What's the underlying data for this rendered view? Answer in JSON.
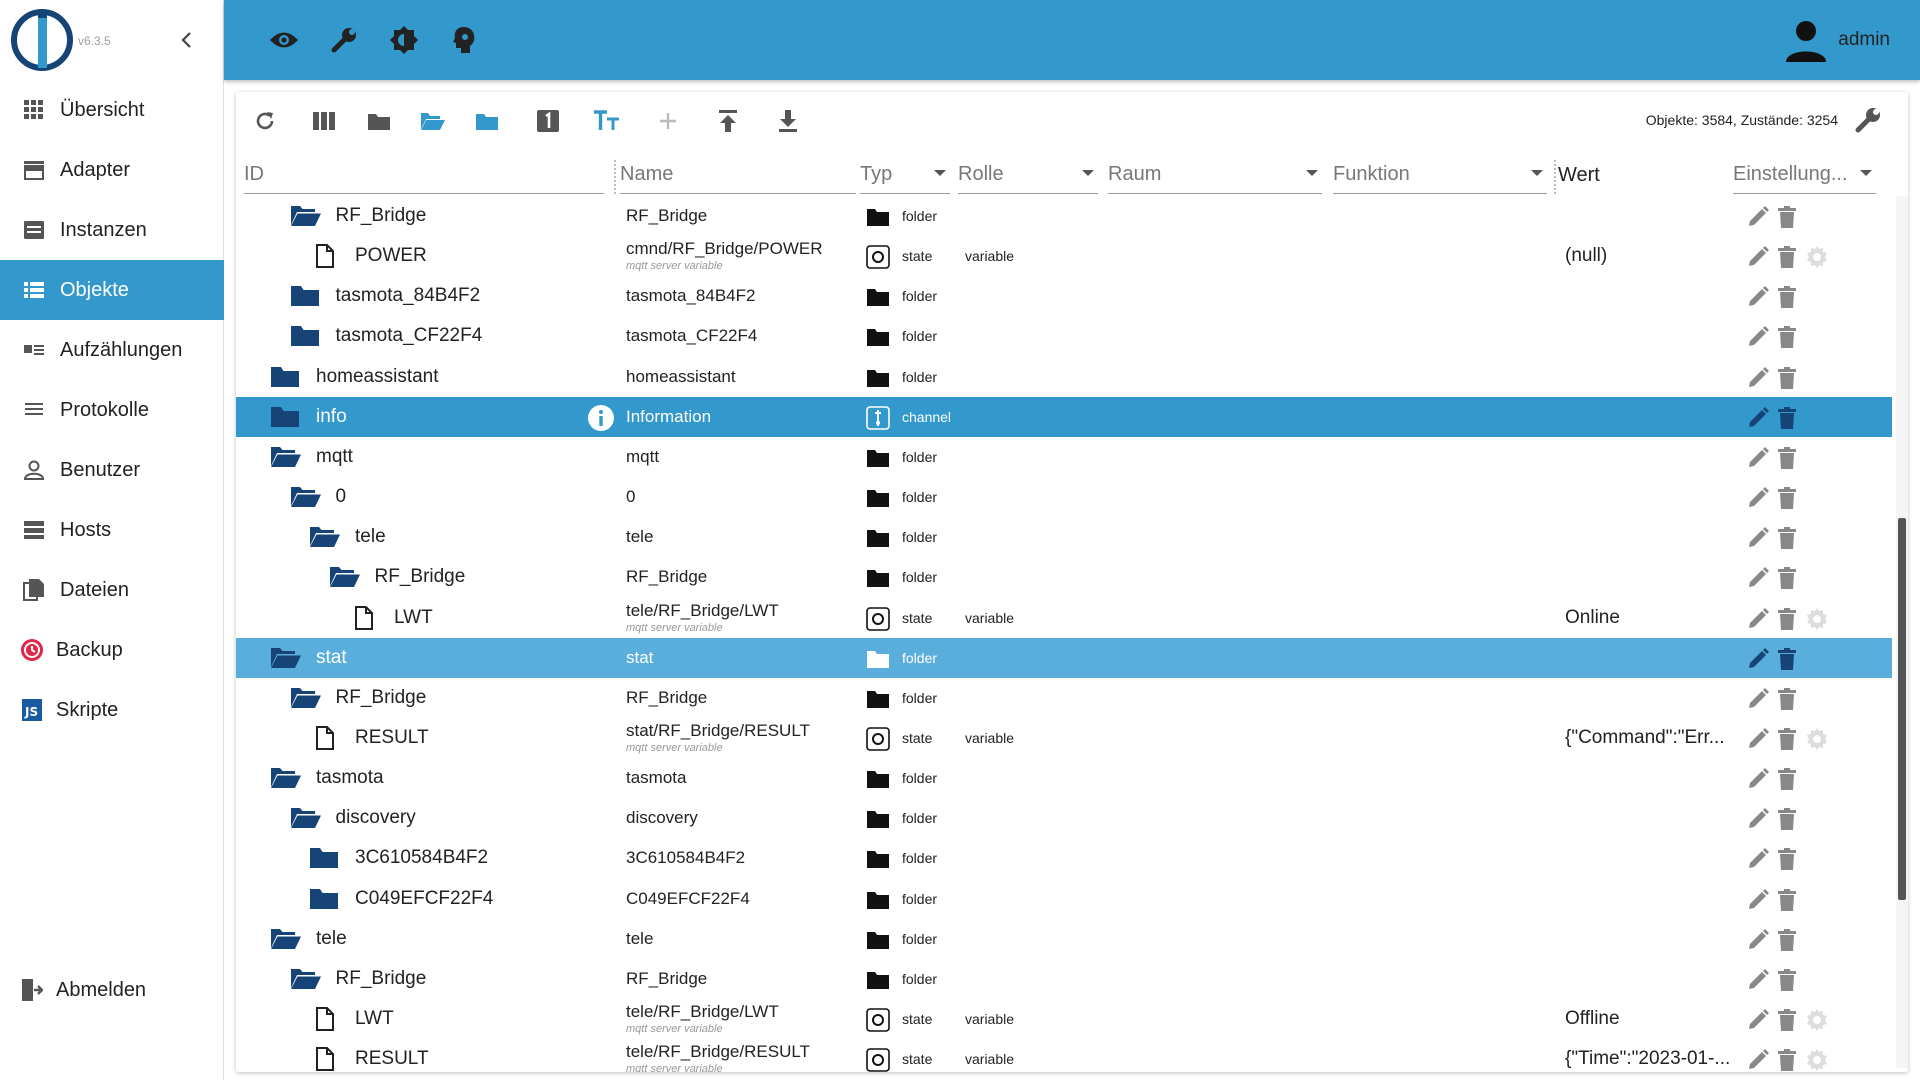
{
  "app": {
    "version": "v6.3.5"
  },
  "sidebar": {
    "items": [
      {
        "label": "Übersicht",
        "icon": "grid-icon",
        "active": false
      },
      {
        "label": "Adapter",
        "icon": "store-icon",
        "active": false
      },
      {
        "label": "Instanzen",
        "icon": "instances-icon",
        "active": false
      },
      {
        "label": "Objekte",
        "icon": "list-icon",
        "active": true
      },
      {
        "label": "Aufzählungen",
        "icon": "enums-icon",
        "active": false
      },
      {
        "label": "Protokolle",
        "icon": "logs-icon",
        "active": false
      },
      {
        "label": "Benutzer",
        "icon": "user-icon",
        "active": false
      },
      {
        "label": "Hosts",
        "icon": "hosts-icon",
        "active": false
      },
      {
        "label": "Dateien",
        "icon": "files-icon",
        "active": false
      },
      {
        "label": "Backup",
        "icon": "backup-icon",
        "active": false
      },
      {
        "label": "Skripte",
        "icon": "scripts-icon",
        "active": false
      }
    ],
    "logout_label": "Abmelden"
  },
  "header": {
    "buttons": [
      "eye-icon",
      "wrench-icon",
      "brightness-icon",
      "expert-mode-icon"
    ],
    "username": "admin"
  },
  "toolbar": {
    "buttons": [
      "refresh-icon",
      "columns-icon",
      "folder-icon",
      "folder-open-icon",
      "folder-blue-icon",
      "number-1-icon",
      "text-size-icon",
      "add-icon",
      "upload-icon",
      "download-icon"
    ],
    "counts": "Objekte: 3584, Zustände: 3254"
  },
  "columns": {
    "id": "ID",
    "name": "Name",
    "typ": "Typ",
    "rolle": "Rolle",
    "raum": "Raum",
    "funktion": "Funktion",
    "wert": "Wert",
    "einstellung": "Einstellung..."
  },
  "rows": [
    {
      "id": "RF_Bridge",
      "indent": 2,
      "icon": "folder-open",
      "name": "RF_Bridge",
      "desc": "",
      "type": "folder",
      "role": "",
      "value": "",
      "gear": false,
      "sel": ""
    },
    {
      "id": "POWER",
      "indent": 3,
      "icon": "file",
      "name": "cmnd/RF_Bridge/POWER",
      "desc": "mqtt server variable",
      "type": "state",
      "role": "variable",
      "value": "(null)",
      "gear": true,
      "sel": ""
    },
    {
      "id": "tasmota_84B4F2",
      "indent": 2,
      "icon": "folder",
      "name": "tasmota_84B4F2",
      "desc": "",
      "type": "folder",
      "role": "",
      "value": "",
      "gear": false,
      "sel": ""
    },
    {
      "id": "tasmota_CF22F4",
      "indent": 2,
      "icon": "folder",
      "name": "tasmota_CF22F4",
      "desc": "",
      "type": "folder",
      "role": "",
      "value": "",
      "gear": false,
      "sel": ""
    },
    {
      "id": "homeassistant",
      "indent": 1,
      "icon": "folder",
      "name": "homeassistant",
      "desc": "",
      "type": "folder",
      "role": "",
      "value": "",
      "gear": false,
      "sel": ""
    },
    {
      "id": "info",
      "indent": 1,
      "icon": "folder",
      "name": "Information",
      "desc": "",
      "type": "channel",
      "role": "",
      "value": "",
      "gear": false,
      "sel": "dark",
      "info": true
    },
    {
      "id": "mqtt",
      "indent": 1,
      "icon": "folder-open",
      "name": "mqtt",
      "desc": "",
      "type": "folder",
      "role": "",
      "value": "",
      "gear": false,
      "sel": ""
    },
    {
      "id": "0",
      "indent": 2,
      "icon": "folder-open",
      "name": "0",
      "desc": "",
      "type": "folder",
      "role": "",
      "value": "",
      "gear": false,
      "sel": ""
    },
    {
      "id": "tele",
      "indent": 3,
      "icon": "folder-open",
      "name": "tele",
      "desc": "",
      "type": "folder",
      "role": "",
      "value": "",
      "gear": false,
      "sel": ""
    },
    {
      "id": "RF_Bridge",
      "indent": 4,
      "icon": "folder-open",
      "name": "RF_Bridge",
      "desc": "",
      "type": "folder",
      "role": "",
      "value": "",
      "gear": false,
      "sel": ""
    },
    {
      "id": "LWT",
      "indent": 5,
      "icon": "file",
      "name": "tele/RF_Bridge/LWT",
      "desc": "mqtt server variable",
      "type": "state",
      "role": "variable",
      "value": "Online",
      "gear": true,
      "sel": ""
    },
    {
      "id": "stat",
      "indent": 1,
      "icon": "folder-open",
      "name": "stat",
      "desc": "",
      "type": "folder",
      "role": "",
      "value": "",
      "gear": false,
      "sel": "light"
    },
    {
      "id": "RF_Bridge",
      "indent": 2,
      "icon": "folder-open",
      "name": "RF_Bridge",
      "desc": "",
      "type": "folder",
      "role": "",
      "value": "",
      "gear": false,
      "sel": ""
    },
    {
      "id": "RESULT",
      "indent": 3,
      "icon": "file",
      "name": "stat/RF_Bridge/RESULT",
      "desc": "mqtt server variable",
      "type": "state",
      "role": "variable",
      "value": "{\"Command\":\"Err...",
      "gear": true,
      "sel": ""
    },
    {
      "id": "tasmota",
      "indent": 1,
      "icon": "folder-open",
      "name": "tasmota",
      "desc": "",
      "type": "folder",
      "role": "",
      "value": "",
      "gear": false,
      "sel": ""
    },
    {
      "id": "discovery",
      "indent": 2,
      "icon": "folder-open",
      "name": "discovery",
      "desc": "",
      "type": "folder",
      "role": "",
      "value": "",
      "gear": false,
      "sel": ""
    },
    {
      "id": "3C610584B4F2",
      "indent": 3,
      "icon": "folder",
      "name": "3C610584B4F2",
      "desc": "",
      "type": "folder",
      "role": "",
      "value": "",
      "gear": false,
      "sel": ""
    },
    {
      "id": "C049EFCF22F4",
      "indent": 3,
      "icon": "folder",
      "name": "C049EFCF22F4",
      "desc": "",
      "type": "folder",
      "role": "",
      "value": "",
      "gear": false,
      "sel": ""
    },
    {
      "id": "tele",
      "indent": 1,
      "icon": "folder-open",
      "name": "tele",
      "desc": "",
      "type": "folder",
      "role": "",
      "value": "",
      "gear": false,
      "sel": ""
    },
    {
      "id": "RF_Bridge",
      "indent": 2,
      "icon": "folder-open",
      "name": "RF_Bridge",
      "desc": "",
      "type": "folder",
      "role": "",
      "value": "",
      "gear": false,
      "sel": ""
    },
    {
      "id": "LWT",
      "indent": 3,
      "icon": "file",
      "name": "tele/RF_Bridge/LWT",
      "desc": "mqtt server variable",
      "type": "state",
      "role": "variable",
      "value": "Offline",
      "gear": true,
      "sel": ""
    },
    {
      "id": "RESULT",
      "indent": 3,
      "icon": "file",
      "name": "tele/RF_Bridge/RESULT",
      "desc": "mqtt server variable",
      "type": "state",
      "role": "variable",
      "value": "{\"Time\":\"2023-01-...",
      "gear": true,
      "sel": ""
    }
  ],
  "colors": {
    "accent": "#3399cc",
    "selected_light": "#5aaedb",
    "folder": "#164477"
  }
}
